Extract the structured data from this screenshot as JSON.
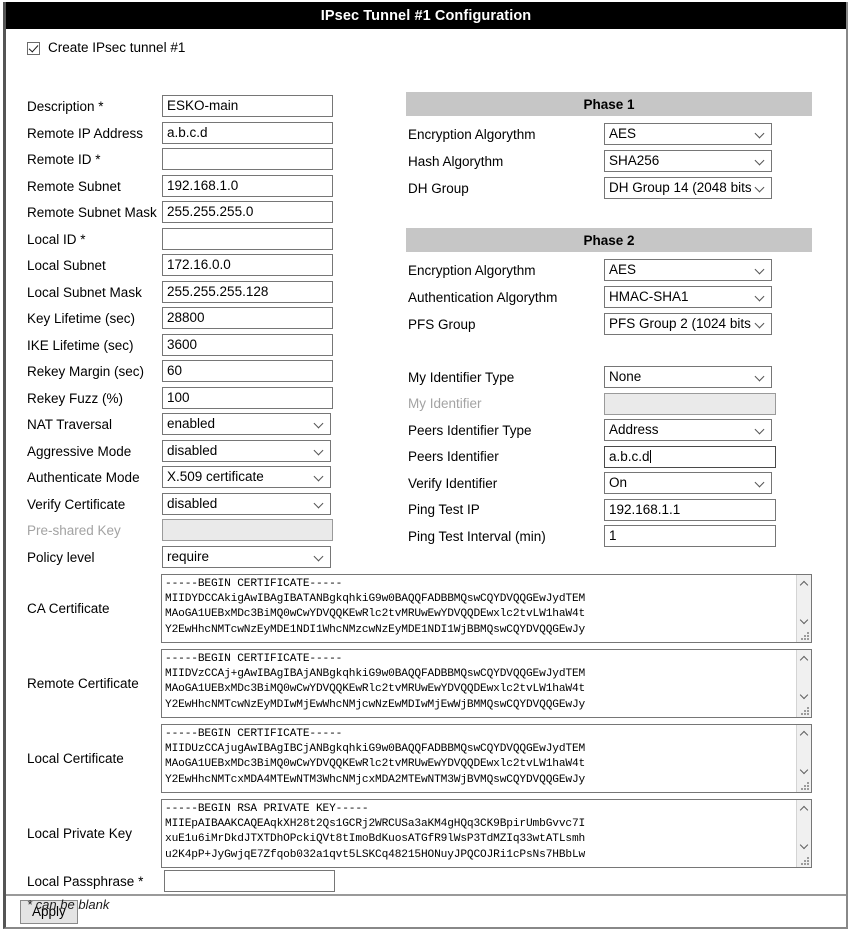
{
  "window": {
    "title": "IPsec Tunnel #1 Configuration"
  },
  "enable": {
    "label": "Create IPsec tunnel #1",
    "checked": "checked"
  },
  "left_fields": [
    {
      "label": "Description *",
      "type": "text",
      "value": "ESKO-main"
    },
    {
      "label": "Remote IP Address",
      "type": "text",
      "value": "a.b.c.d"
    },
    {
      "label": "Remote ID *",
      "type": "text",
      "value": ""
    },
    {
      "label": "Remote Subnet",
      "type": "text",
      "value": "192.168.1.0"
    },
    {
      "label": "Remote Subnet Mask",
      "type": "text",
      "value": "255.255.255.0"
    },
    {
      "label": "Local ID *",
      "type": "text",
      "value": ""
    },
    {
      "label": "Local Subnet",
      "type": "text",
      "value": "172.16.0.0"
    },
    {
      "label": "Local Subnet Mask",
      "type": "text",
      "value": "255.255.255.128"
    },
    {
      "label": "Key Lifetime (sec)",
      "type": "text",
      "value": "28800"
    },
    {
      "label": "IKE Lifetime (sec)",
      "type": "text",
      "value": "3600"
    },
    {
      "label": "Rekey Margin (sec)",
      "type": "text",
      "value": "60"
    },
    {
      "label": "Rekey Fuzz (%)",
      "type": "text",
      "value": "100"
    },
    {
      "label": "NAT Traversal",
      "type": "select",
      "value": "enabled"
    },
    {
      "label": "Aggressive Mode",
      "type": "select",
      "value": "disabled"
    },
    {
      "label": "Authenticate Mode",
      "type": "select",
      "value": "X.509 certificate"
    },
    {
      "label": "Verify Certificate",
      "type": "select",
      "value": "disabled"
    },
    {
      "label": "Pre-shared Key",
      "type": "text",
      "value": "",
      "disabled": "true"
    },
    {
      "label": "Policy level",
      "type": "select",
      "value": "require"
    }
  ],
  "phase1": {
    "title": "Phase 1",
    "fields": [
      {
        "label": "Encryption Algorythm",
        "type": "select",
        "value": "AES"
      },
      {
        "label": "Hash Algorythm",
        "type": "select",
        "value": "SHA256"
      },
      {
        "label": "DH Group",
        "type": "select",
        "value": "DH Group 14 (2048 bits)"
      }
    ]
  },
  "phase2": {
    "title": "Phase 2",
    "fields": [
      {
        "label": "Encryption Algorythm",
        "type": "select",
        "value": "AES"
      },
      {
        "label": "Authentication Algorythm",
        "type": "select",
        "value": "HMAC-SHA1"
      },
      {
        "label": "PFS Group",
        "type": "select",
        "value": "PFS Group 2 (1024 bits)"
      }
    ]
  },
  "identifiers": [
    {
      "label": "My Identifier Type",
      "type": "select",
      "value": "None"
    },
    {
      "label": "My Identifier",
      "type": "text",
      "value": "",
      "disabled": "true"
    },
    {
      "label": "Peers Identifier Type",
      "type": "select",
      "value": "Address"
    },
    {
      "label": "Peers Identifier",
      "type": "text",
      "value": "a.b.c.d",
      "focused": "true"
    },
    {
      "label": "Verify Identifier",
      "type": "select",
      "value": "On"
    },
    {
      "label": "Ping Test IP",
      "type": "text",
      "value": "192.168.1.1"
    },
    {
      "label": "Ping Test Interval (min)",
      "type": "text",
      "value": "1"
    }
  ],
  "textareas": [
    {
      "label": "CA Certificate",
      "value": "-----BEGIN CERTIFICATE-----\nMIIDYDCCAkigAwIBAgIBATANBgkqhkiG9w0BAQQFADBBMQswCQYDVQQGEwJydTEM\nMAoGA1UEBxMDc3BiMQ0wCwYDVQQKEwRlc2tvMRUwEwYDVQQDEwxlc2tvLW1haW4t\nY2EwHhcNMTcwNzEyMDE1NDI1WhcNMzcwNzEyMDE1NDI1WjBBMQswCQYDVQQGEwJy"
    },
    {
      "label": "Remote Certificate",
      "value": "-----BEGIN CERTIFICATE-----\nMIIDVzCCAj+gAwIBAgIBAjANBgkqhkiG9w0BAQQFADBBMQswCQYDVQQGEwJydTEM\nMAoGA1UEBxMDc3BiMQ0wCwYDVQQKEwRlc2tvMRUwEwYDVQQDEwxlc2tvLW1haW4t\nY2EwHhcNMTcwNzEyMDIwMjEwWhcNMjcwNzEwMDIwMjEwWjBMMQswCQYDVQQGEwJy"
    },
    {
      "label": "Local Certificate",
      "value": "-----BEGIN CERTIFICATE-----\nMIIDUzCCAjugAwIBAgIBCjANBgkqhkiG9w0BAQQFADBBMQswCQYDVQQGEwJydTEM\nMAoGA1UEBxMDc3BiMQ0wCwYDVQQKEwRlc2tvMRUwEwYDVQQDEwxlc2tvLW1haW4t\nY2EwHhcNMTcxMDA4MTEwNTM3WhcNMjcxMDA2MTEwNTM3WjBVMQswCQYDVQQGEwJy"
    },
    {
      "label": "Local Private Key",
      "value": "-----BEGIN RSA PRIVATE KEY-----\nMIIEpAIBAAKCAQEAqkXH28t2Qs1GCRj2WRCUSa3aKM4gHQq3CK9BpirUmbGvvc7I\nxuE1u6iMrDkdJTXTDhOPckiQVt8tImoBdKuosATGfR9lWsP3TdMZIq33wtATLsmh\nu2K4pP+JyGwjqE7Zfqob032a1qvt5LSKCq48215HONuyJPQCOJRi1cPsNs7HBbLw"
    }
  ],
  "passphrase": {
    "label": "Local Passphrase *",
    "value": ""
  },
  "footnote": "* can be blank",
  "apply": {
    "label": "Apply"
  }
}
